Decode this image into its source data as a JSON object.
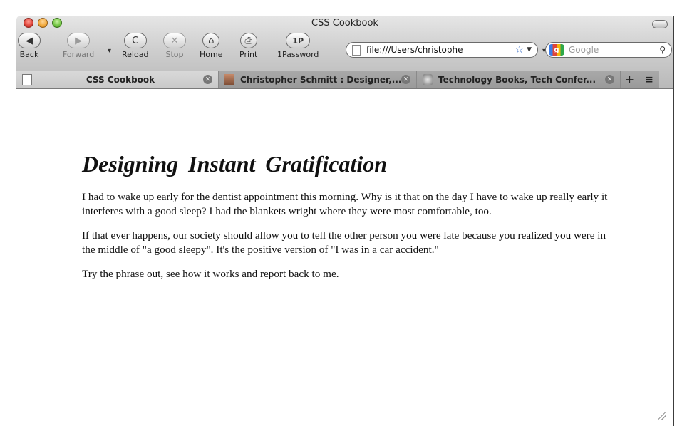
{
  "window": {
    "title": "CSS Cookbook"
  },
  "toolbar": {
    "back_label": "Back",
    "back_icon": "◀",
    "forward_label": "Forward",
    "forward_icon": "▶",
    "reload_label": "Reload",
    "reload_icon": "C",
    "stop_label": "Stop",
    "stop_icon": "✕",
    "home_label": "Home",
    "home_icon": "⌂",
    "print_label": "Print",
    "print_icon": "⎙",
    "onepassword_label": "1Password",
    "onepassword_icon": "1P",
    "url": "file:///Users/christophe",
    "search_placeholder": "Google"
  },
  "tabs": [
    {
      "title": "CSS Cookbook",
      "active": true
    },
    {
      "title": "Christopher Schmitt : Designer,...",
      "active": false
    },
    {
      "title": "Technology Books, Tech Confer...",
      "active": false
    }
  ],
  "article": {
    "heading": "Designing Instant Gratification",
    "paragraphs": [
      "I had to wake up early for the dentist appointment this morning. Why is it that on the day I have to wake up really early it interferes with a good sleep? I had the blankets wright where they were most comfortable, too.",
      "If that ever happens, our society should allow you to tell the other person you were late because you realized you were in the middle of \"a good sleepy\". It's the positive version of \"I was in a car accident.\"",
      "Try the phrase out, see how it works and report back to me."
    ]
  },
  "colors": {
    "close": "#e0443a",
    "minimize": "#f1a83a",
    "zoom": "#6fc240",
    "bookmark_star": "#3a6ec6"
  }
}
